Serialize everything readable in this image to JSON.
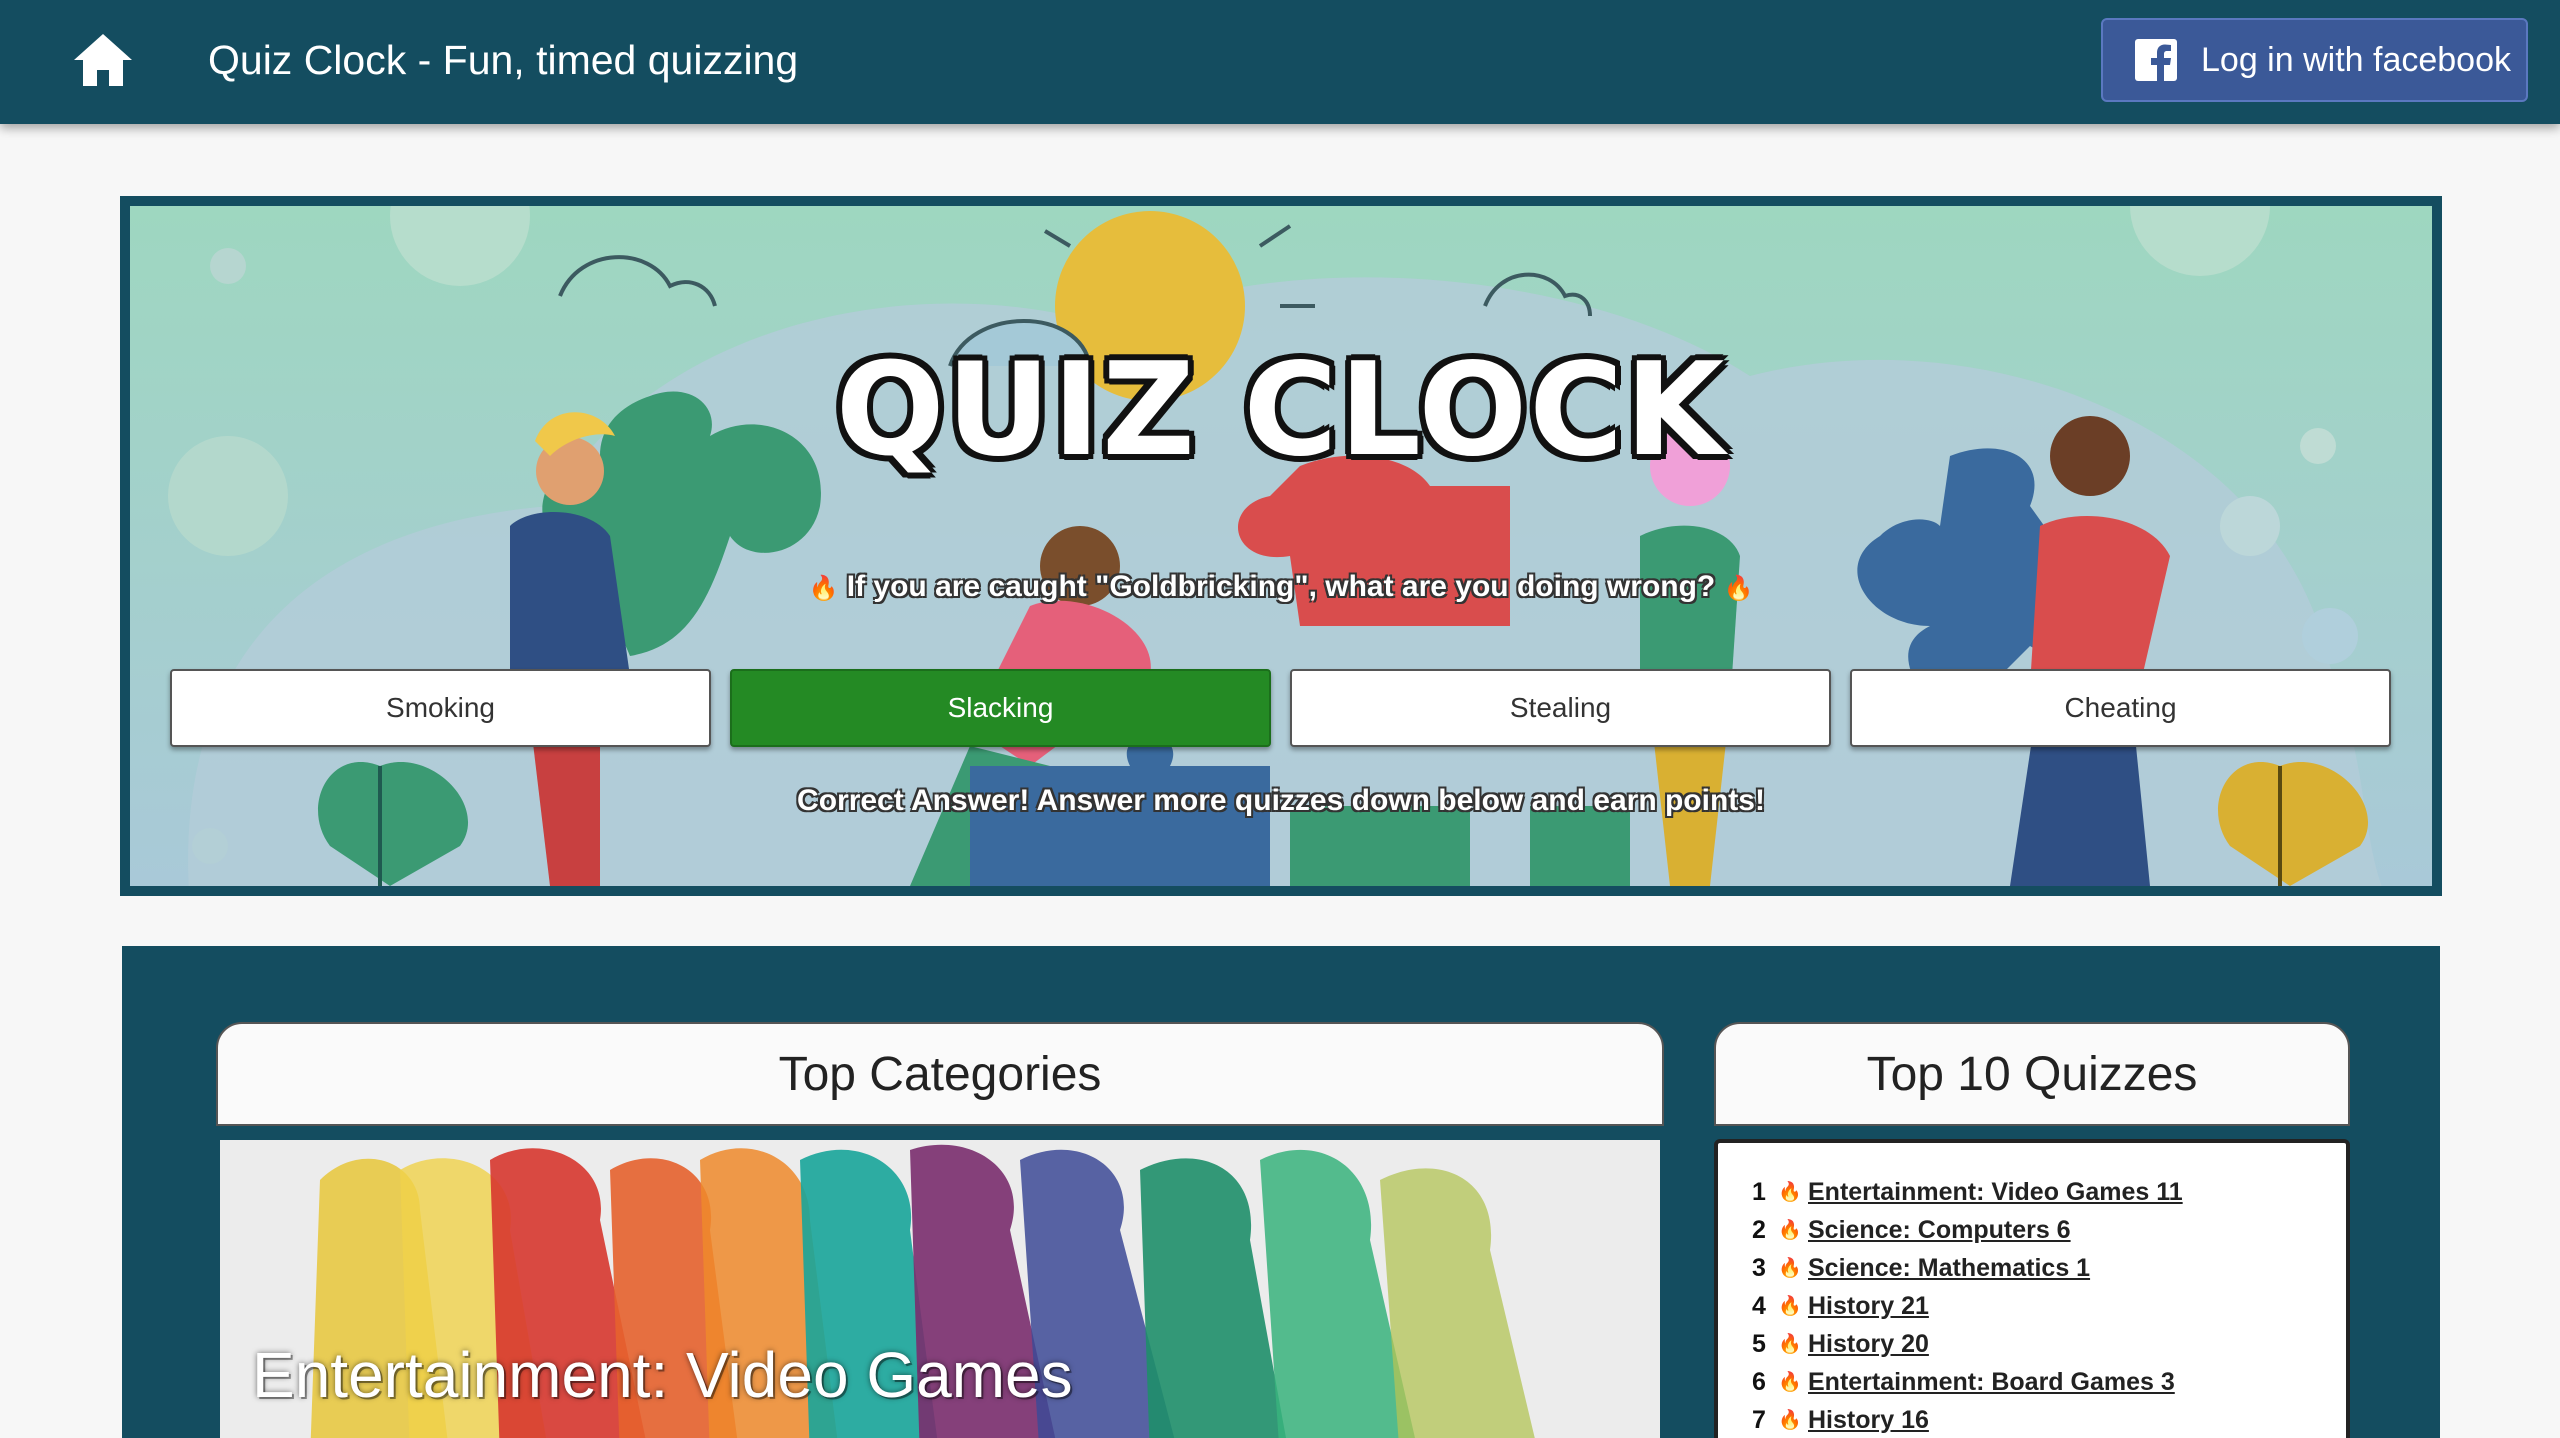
{
  "header": {
    "title": "Quiz Clock - Fun, timed quizzing",
    "login_label": "Log in with facebook",
    "home_icon": "home-icon",
    "facebook_icon": "facebook-icon"
  },
  "hero": {
    "logo_text": "QUIZ CLOCK",
    "question": "If you are caught \"Goldbricking\", what are you doing wrong?",
    "answers": [
      {
        "label": "Smoking",
        "correct": false
      },
      {
        "label": "Slacking",
        "correct": true
      },
      {
        "label": "Stealing",
        "correct": false
      },
      {
        "label": "Cheating",
        "correct": false
      }
    ],
    "feedback": "Correct Answer! Answer more quizzes down below and earn points!"
  },
  "top_categories": {
    "heading": "Top Categories",
    "featured": "Entertainment: Video Games"
  },
  "top_quizzes": {
    "heading": "Top 10 Quizzes",
    "items": [
      {
        "rank": "1",
        "title": "Entertainment: Video Games 11"
      },
      {
        "rank": "2",
        "title": "Science: Computers 6"
      },
      {
        "rank": "3",
        "title": "Science: Mathematics 1"
      },
      {
        "rank": "4",
        "title": "History 21"
      },
      {
        "rank": "5",
        "title": "History 20"
      },
      {
        "rank": "6",
        "title": "Entertainment: Board Games 3"
      },
      {
        "rank": "7",
        "title": "History 16"
      }
    ]
  },
  "colors": {
    "header_bg": "#144d60",
    "facebook_blue": "#3b5998",
    "correct_green": "#248a24",
    "hot_icon": "#e04a2b"
  }
}
